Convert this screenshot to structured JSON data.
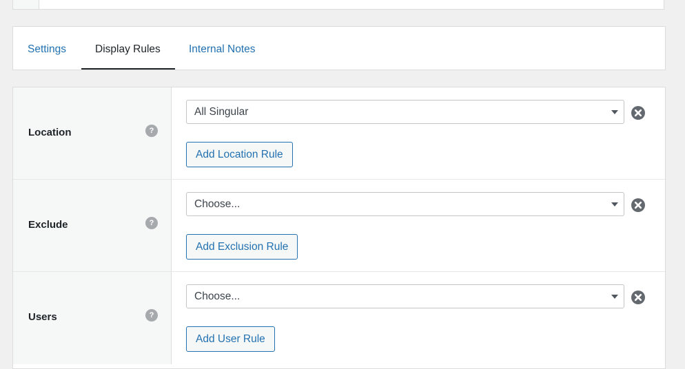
{
  "tabs": [
    {
      "label": "Settings",
      "active": false
    },
    {
      "label": "Display Rules",
      "active": true
    },
    {
      "label": "Internal Notes",
      "active": false
    }
  ],
  "rules": [
    {
      "label": "Location",
      "help": "?",
      "selected": "All Singular",
      "button": "Add Location Rule"
    },
    {
      "label": "Exclude",
      "help": "?",
      "selected": "Choose...",
      "button": "Add Exclusion Rule"
    },
    {
      "label": "Users",
      "help": "?",
      "selected": "Choose...",
      "button": "Add User Rule"
    }
  ],
  "colors": {
    "link": "#2271b1",
    "text": "#1d2327",
    "background": "#f0f0f1"
  }
}
